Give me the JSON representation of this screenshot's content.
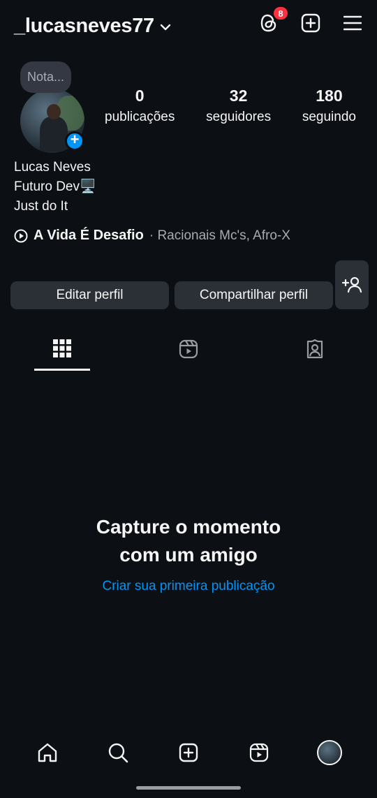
{
  "header": {
    "username": "_lucasneves77",
    "threads_badge": "8"
  },
  "note": {
    "label": "Nota..."
  },
  "stats": [
    {
      "value": "0",
      "label": "publicações"
    },
    {
      "value": "32",
      "label": "seguidores"
    },
    {
      "value": "180",
      "label": "seguindo"
    }
  ],
  "bio": {
    "name": "Lucas Neves",
    "line1": "Futuro Dev🖥️",
    "line2": "Just do It"
  },
  "music": {
    "song": "A Vida É Desafio",
    "artists": "· Racionais Mc's, Afro-X"
  },
  "actions": {
    "edit": "Editar perfil",
    "share": "Compartilhar perfil"
  },
  "empty_state": {
    "title_line1": "Capture o momento",
    "title_line2": "com um amigo",
    "link": "Criar sua primeira publicação"
  },
  "colors": {
    "background": "#0c0f14",
    "accent": "#0095f6",
    "badge": "#ff3040",
    "button": "#2b2f36"
  }
}
